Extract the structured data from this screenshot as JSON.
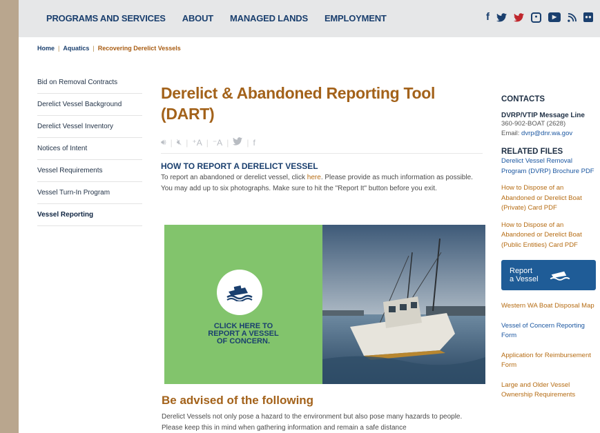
{
  "nav": {
    "links": [
      "PROGRAMS AND SERVICES",
      "ABOUT",
      "MANAGED LANDS",
      "EMPLOYMENT"
    ],
    "social": [
      "facebook-icon",
      "twitter-icon",
      "pinterest-icon",
      "instagram-icon",
      "youtube-icon",
      "rss-icon",
      "flickr-icon"
    ]
  },
  "breadcrumb": {
    "home": "Home",
    "aquatics": "Aquatics",
    "current": "Recovering Derelict Vessels"
  },
  "sidebar": {
    "items": [
      "Bid on Removal Contracts",
      "Derelict Vessel Background",
      "Derelict Vessel Inventory",
      "Notices of Intent",
      "Vessel Requirements",
      "Vessel Turn-In Program",
      "Vessel Reporting"
    ],
    "active_index": 6
  },
  "main": {
    "title": "Derelict & Abandoned Reporting Tool (DART)",
    "toolbar": [
      "audio-on-icon",
      "audio-off-icon",
      "font-increase-icon",
      "font-decrease-icon",
      "twitter-icon",
      "facebook-icon"
    ],
    "report_heading": "HOW TO REPORT A DERELICT VESSEL",
    "report_text_before": "To report an abandoned or derelict vessel, click ",
    "report_link": "here",
    "report_text_after": ". Please provide as much information as possible. You may add up to six photographs. Make sure to hit the \"Report It\" button before you exit.",
    "banner_cta_line1": "CLICK HERE TO",
    "banner_cta_line2": "REPORT A VESSEL",
    "banner_cta_line3": "OF CONCERN.",
    "advised_heading": "Be advised of the following",
    "advised_text": "Derelict Vessels not only pose a hazard to the environment but also pose many hazards to people.  Please keep this in mind when gathering information and remain a safe distance"
  },
  "right": {
    "contacts_heading": "CONTACTS",
    "contact_name": "DVRP/VTIP Message Line",
    "contact_phone": "360-902-BOAT (2628)",
    "contact_email_label": "Email: ",
    "contact_email": "dvrp@dnr.wa.gov",
    "related_heading": "RELATED FILES",
    "related_links": [
      "Derelict Vessel Removal Program (DVRP) Brochure PDF",
      "How to Dispose of an Abandoned or Derelict Boat (Private) Card PDF",
      "How to Dispose of an Abandoned or Derelict Boat (Public Entities) Card PDF"
    ],
    "report_button_line1": "Report",
    "report_button_line2": "a Vessel",
    "more_links": [
      "Western WA Boat Disposal Map",
      "Vessel of Concern Reporting Form",
      "Application for Reimbursement Form",
      "Large and Older Vessel Ownership Requirements"
    ]
  },
  "colors": {
    "nav_blue": "#1a3f6e",
    "heading_orange": "#a3621a",
    "link_orange": "#b56b12",
    "banner_green": "#82c46c",
    "button_blue": "#1f5c97"
  }
}
